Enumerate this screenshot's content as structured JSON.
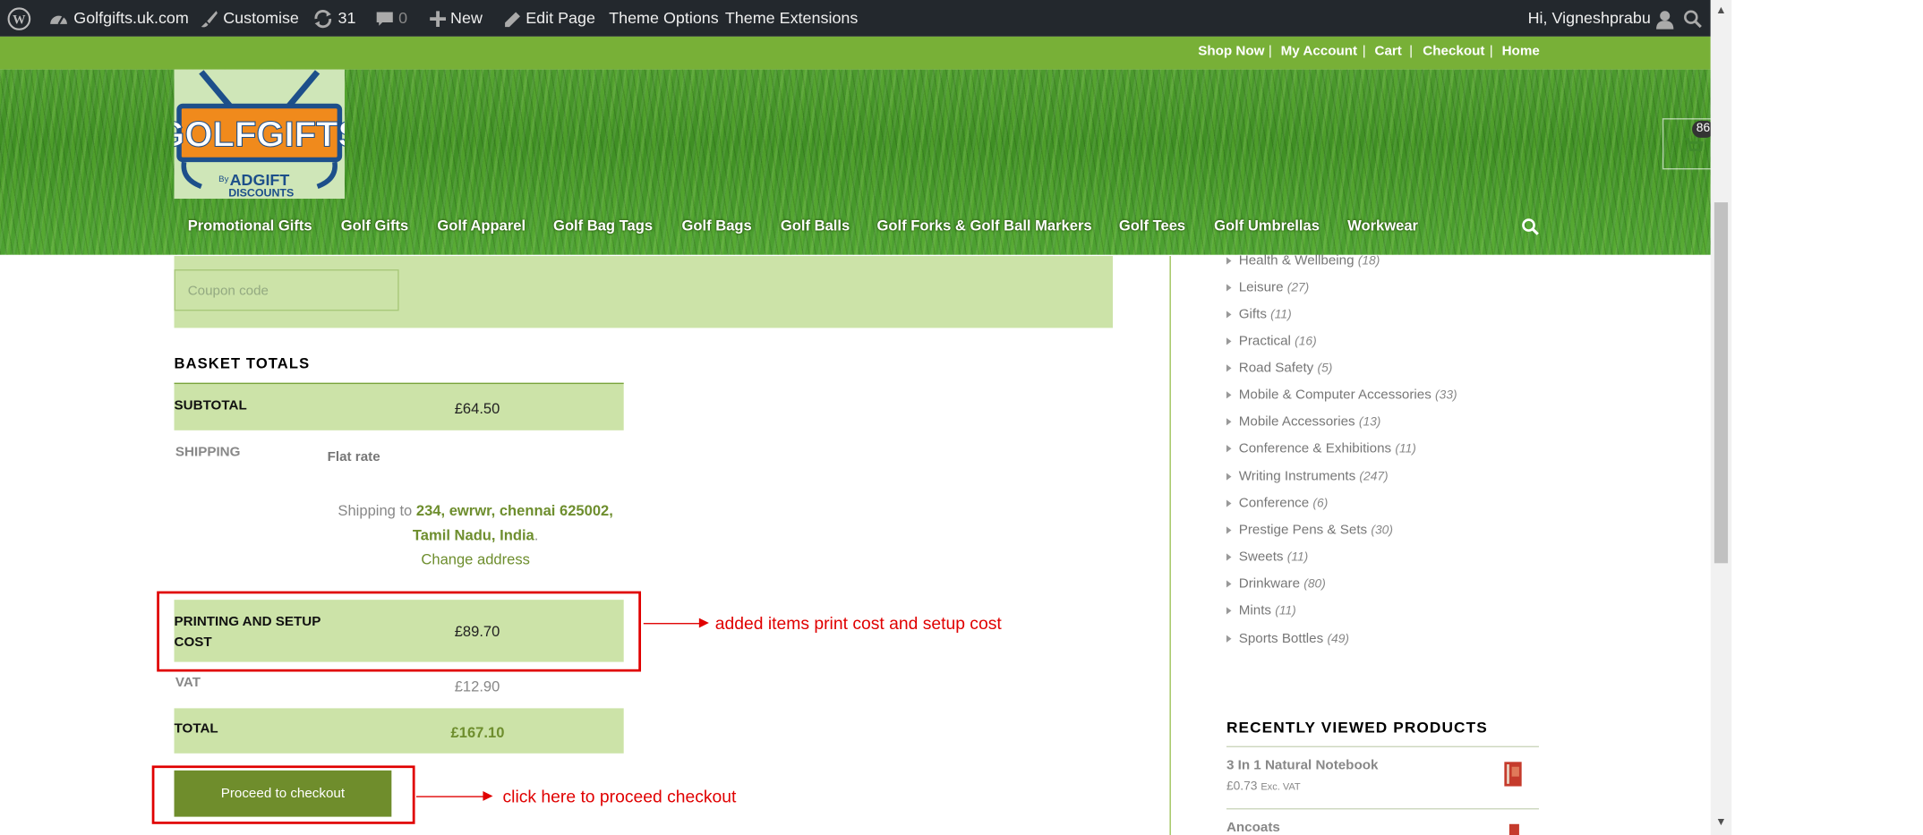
{
  "admin_bar": {
    "site_name": "Golfgifts.uk.com",
    "customise": "Customise",
    "updates_count": "31",
    "comments_count": "0",
    "new": "New",
    "edit_page": "Edit Page",
    "theme_options": "Theme Options",
    "theme_extensions": "Theme Extensions",
    "greeting": "Hi, Vigneshprabu"
  },
  "top_nav": {
    "items": [
      "Shop Now",
      "My Account",
      "Cart",
      "Checkout",
      "Home"
    ],
    "separator": "|"
  },
  "logo": {
    "text_main": "GOLFGIFTS",
    "text_by": "By",
    "text_brand": "ADGIFT",
    "text_sub": "DISCOUNTS"
  },
  "cart_badge": "86",
  "main_nav": {
    "items": [
      "Promotional Gifts",
      "Golf Gifts",
      "Golf Apparel",
      "Golf Bag Tags",
      "Golf Bags",
      "Golf Balls",
      "Golf Forks & Golf Ball Markers",
      "Golf Tees",
      "Golf Umbrellas",
      "Workwear"
    ]
  },
  "coupon": {
    "placeholder": "Coupon code"
  },
  "basket_totals": {
    "title": "BASKET TOTALS",
    "subtotal_label": "SUBTOTAL",
    "subtotal_value": "£64.50",
    "shipping_label": "SHIPPING",
    "shipping_method": "Flat rate",
    "shipping_to_prefix": "Shipping to",
    "shipping_address_1": "234, ewrwr, chennai 625002,",
    "shipping_address_2": "Tamil Nadu, India",
    "shipping_address_end": ".",
    "change_address": "Change address",
    "printing_label_1": "PRINTING AND SETUP",
    "printing_label_2": "COST",
    "printing_value": "£89.70",
    "vat_label": "VAT",
    "vat_value": "£12.90",
    "total_label": "TOTAL",
    "total_value": "£167.10",
    "checkout_button": "Proceed to checkout"
  },
  "annotations": {
    "print_cost_note": "added items print cost and setup cost",
    "checkout_note": "click here to proceed checkout",
    "color": "#e00000"
  },
  "sidebar": {
    "categories": [
      {
        "name": "Health & Wellbeing",
        "count": "(18)"
      },
      {
        "name": "Leisure",
        "count": "(27)"
      },
      {
        "name": "Gifts",
        "count": "(11)"
      },
      {
        "name": "Practical",
        "count": "(16)"
      },
      {
        "name": "Road Safety",
        "count": "(5)"
      },
      {
        "name": "Mobile & Computer Accessories",
        "count": "(33)"
      },
      {
        "name": "Mobile Accessories",
        "count": "(13)"
      },
      {
        "name": "Conference & Exhibitions",
        "count": "(11)"
      },
      {
        "name": "Writing Instruments",
        "count": "(247)"
      },
      {
        "name": "Conference",
        "count": "(6)"
      },
      {
        "name": "Prestige Pens & Sets",
        "count": "(30)"
      },
      {
        "name": "Sweets",
        "count": "(11)"
      },
      {
        "name": "Drinkware",
        "count": "(80)"
      },
      {
        "name": "Mints",
        "count": "(11)"
      },
      {
        "name": "Sports Bottles",
        "count": "(49)"
      }
    ],
    "recently_viewed_title": "RECENTLY VIEWED PRODUCTS",
    "recent_products": [
      {
        "name": "3 In 1 Natural Notebook",
        "price": "£0.73",
        "price_suffix": "Exc. VAT"
      },
      {
        "name": "Ancoats",
        "price": "",
        "price_suffix": ""
      }
    ]
  },
  "colors": {
    "brand_green": "#78b037",
    "panel_green": "#cce3a8",
    "button_green": "#6f8d2c",
    "admin_bar": "#23282d"
  },
  "icons": [
    "wordpress-icon",
    "dashboard-icon",
    "brush-icon",
    "refresh-icon",
    "comment-icon",
    "plus-icon",
    "pencil-icon",
    "user-icon",
    "search-icon",
    "cart-icon"
  ]
}
